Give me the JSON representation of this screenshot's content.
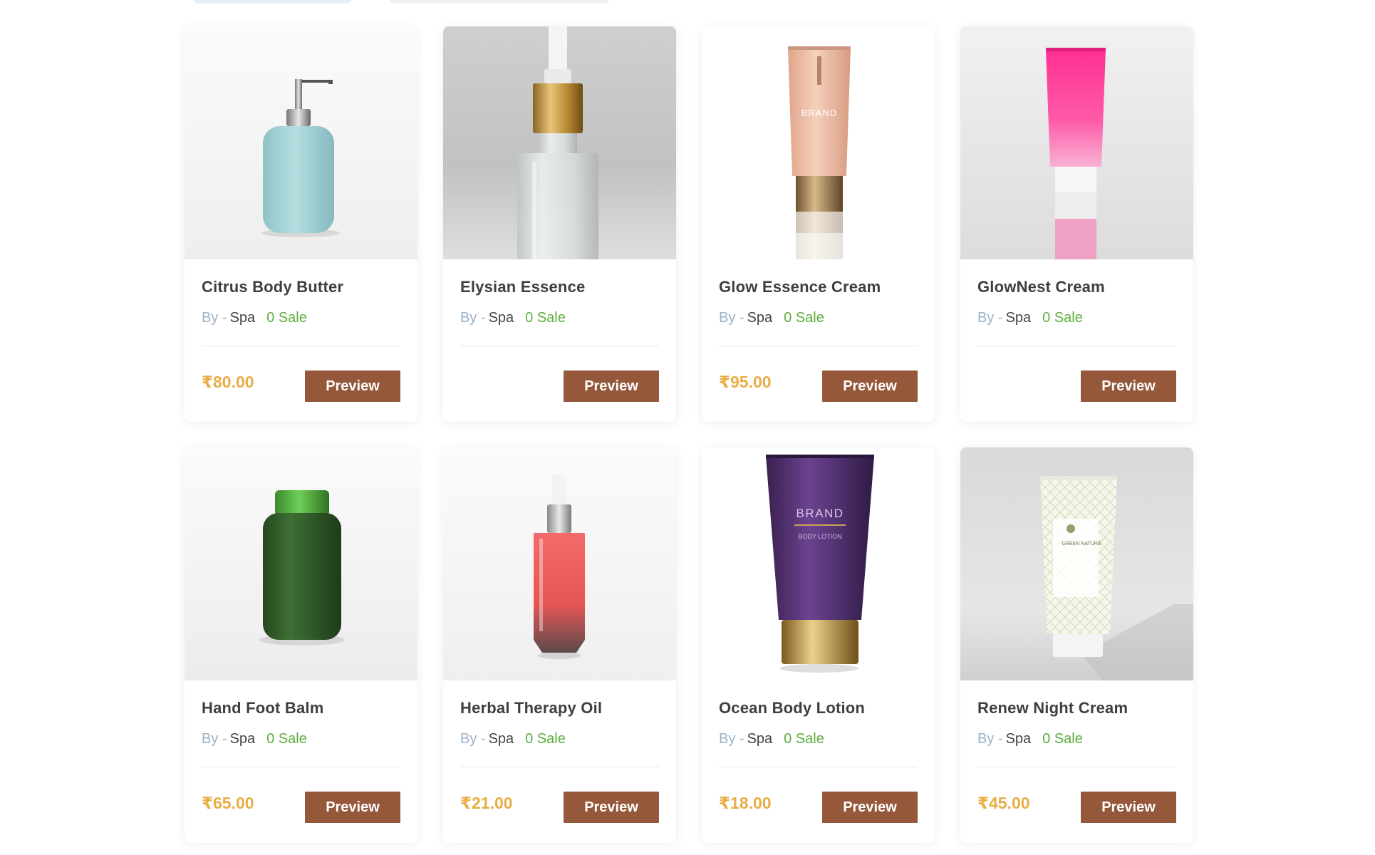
{
  "colors": {
    "button_bg": "#96583a",
    "price": "#e8ad45",
    "sale": "#5cae3c",
    "by_label": "#9ab2c8",
    "title": "#3f3f3f"
  },
  "products": [
    {
      "title": "Citrus Body Butter",
      "by": "By -",
      "author": "Spa",
      "sale": "0 Sale",
      "price": "₹80.00",
      "button": "Preview",
      "image": "pump-bottle-icon"
    },
    {
      "title": "Elysian Essence",
      "by": "By -",
      "author": "Spa",
      "sale": "0 Sale",
      "price": "",
      "button": "Preview",
      "image": "dropper-bottle-icon"
    },
    {
      "title": "Glow Essence Cream",
      "by": "By -",
      "author": "Spa",
      "sale": "0 Sale",
      "price": "₹95.00",
      "button": "Preview",
      "image": "cream-tube-icon"
    },
    {
      "title": "GlowNest Cream",
      "by": "By -",
      "author": "Spa",
      "sale": "0 Sale",
      "price": "",
      "button": "Preview",
      "image": "pink-tube-icon"
    },
    {
      "title": "Hand Foot Balm",
      "by": "By -",
      "author": "Spa",
      "sale": "0 Sale",
      "price": "₹65.00",
      "button": "Preview",
      "image": "green-jar-icon"
    },
    {
      "title": "Herbal Therapy Oil",
      "by": "By -",
      "author": "Spa",
      "sale": "0 Sale",
      "price": "₹21.00",
      "button": "Preview",
      "image": "serum-bottle-icon"
    },
    {
      "title": "Ocean Body Lotion",
      "by": "By -",
      "author": "Spa",
      "sale": "0 Sale",
      "price": "₹18.00",
      "button": "Preview",
      "image": "lotion-tube-icon"
    },
    {
      "title": "Renew Night Cream",
      "by": "By -",
      "author": "Spa",
      "sale": "0 Sale",
      "price": "₹45.00",
      "button": "Preview",
      "image": "patterned-tube-icon"
    }
  ],
  "image_labels": {
    "cream_brand": "BRAND",
    "lotion_brand": "BRAND",
    "lotion_sub": "BODY LOTION",
    "nature_brand": "GREEN NATURE"
  }
}
